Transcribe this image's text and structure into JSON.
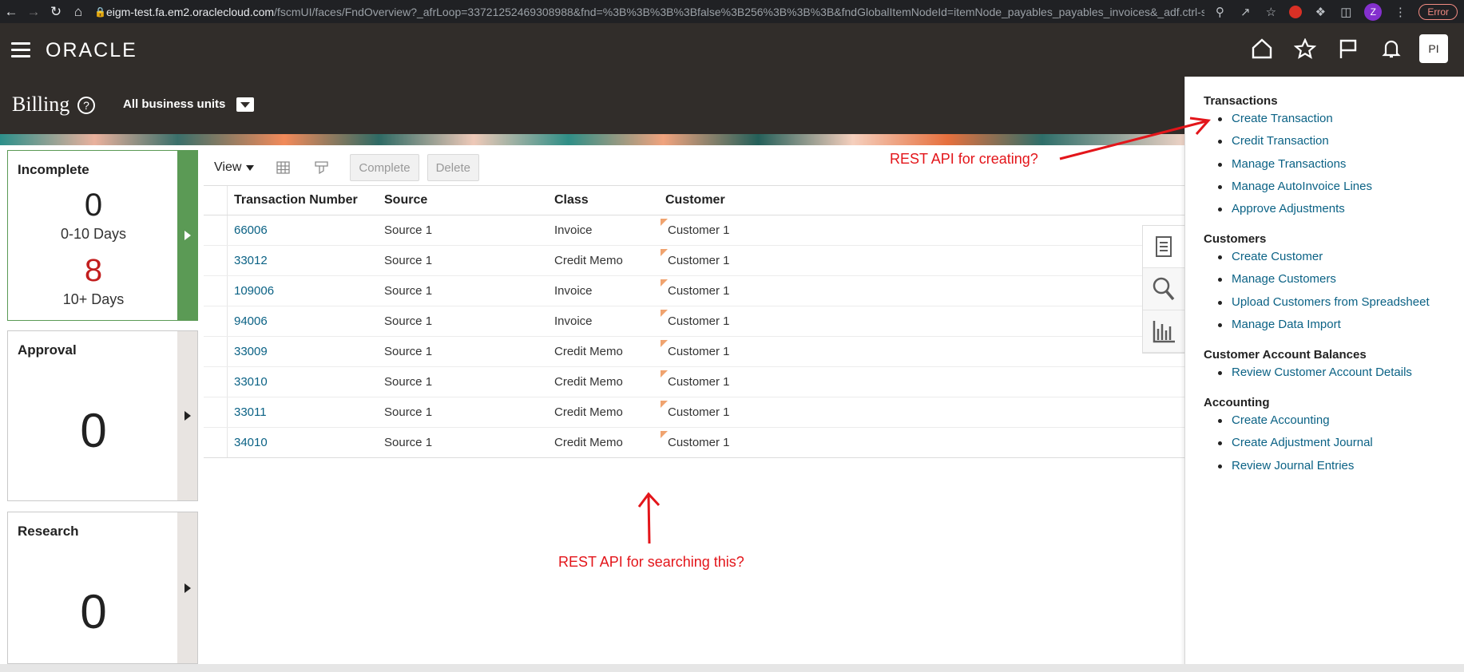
{
  "browser": {
    "url_host": "eigm-test.fa.em2.oraclecloud.com",
    "url_path": "/fscmUI/faces/FndOverview?_afrLoop=33721252469308988&fnd=%3B%3B%3B%3Bfalse%3B256%3B%3B%3B&fndGlobalItemNodeId=itemNode_payables_payables_invoices&_adf.ctrl-st...",
    "profile_initial": "Z",
    "error_label": "Error"
  },
  "header": {
    "logo": "ORACLE",
    "avatar": "PI",
    "page_title": "Billing",
    "business_unit": "All business units"
  },
  "tiles": [
    {
      "title": "Incomplete",
      "value_1": "0",
      "label_1": "0-10 Days",
      "value_2": "8",
      "label_2": "10+ Days"
    },
    {
      "title": "Approval",
      "value": "0"
    },
    {
      "title": "Research",
      "value": "0"
    }
  ],
  "toolbar": {
    "view_label": "View",
    "complete_label": "Complete",
    "delete_label": "Delete"
  },
  "table": {
    "columns": [
      "Transaction Number",
      "Source",
      "Class",
      "Customer"
    ],
    "rows": [
      {
        "number": "66006",
        "source": "Source 1",
        "class": "Invoice",
        "customer": "Customer 1"
      },
      {
        "number": "33012",
        "source": "Source 1",
        "class": "Credit Memo",
        "customer": "Customer 1"
      },
      {
        "number": "109006",
        "source": "Source 1",
        "class": "Invoice",
        "customer": "Customer 1"
      },
      {
        "number": "94006",
        "source": "Source 1",
        "class": "Invoice",
        "customer": "Customer 1"
      },
      {
        "number": "33009",
        "source": "Source 1",
        "class": "Credit Memo",
        "customer": "Customer 1"
      },
      {
        "number": "33010",
        "source": "Source 1",
        "class": "Credit Memo",
        "customer": "Customer 1"
      },
      {
        "number": "33011",
        "source": "Source 1",
        "class": "Credit Memo",
        "customer": "Customer 1"
      },
      {
        "number": "34010",
        "source": "Source 1",
        "class": "Credit Memo",
        "customer": "Customer 1"
      }
    ]
  },
  "tasks": {
    "sections": [
      {
        "title": "Transactions",
        "items": [
          "Create Transaction",
          "Credit Transaction",
          "Manage Transactions",
          "Manage AutoInvoice Lines",
          "Approve Adjustments"
        ]
      },
      {
        "title": "Customers",
        "items": [
          "Create Customer",
          "Manage Customers",
          "Upload Customers from Spreadsheet",
          "Manage Data Import"
        ]
      },
      {
        "title": "Customer Account Balances",
        "items": [
          "Review Customer Account Details"
        ]
      },
      {
        "title": "Accounting",
        "items": [
          "Create Accounting",
          "Create Adjustment Journal",
          "Review Journal Entries"
        ]
      }
    ]
  },
  "annotations": {
    "create_note": "REST API for creating?",
    "search_note": "REST API for searching this?"
  },
  "colors": {
    "header_bg": "#312d2a",
    "link": "#0b6285",
    "alert_red": "#c21e1e",
    "annotation_red": "#e3151a",
    "tile_active": "#5b9a55"
  }
}
